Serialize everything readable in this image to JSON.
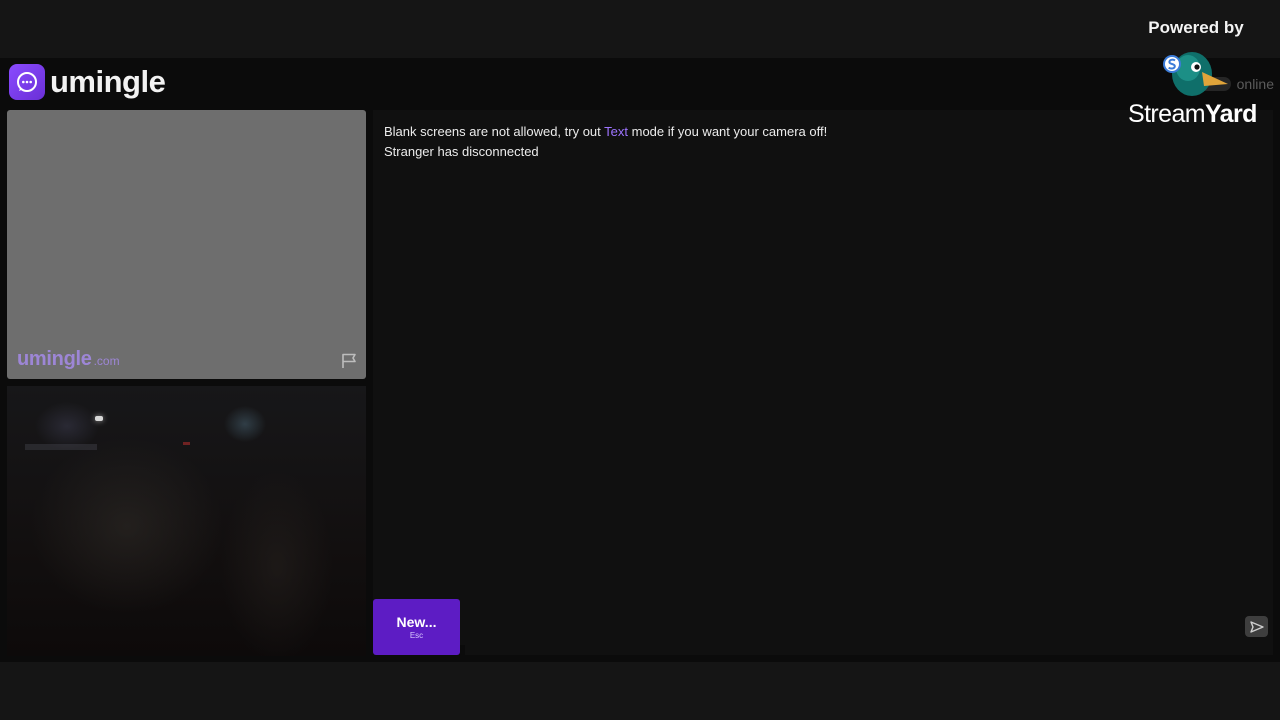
{
  "header": {
    "app_name": "umingle",
    "online_label": "online"
  },
  "stranger_video": {
    "watermark_main": "umingle",
    "watermark_suffix": ".com"
  },
  "chat": {
    "line1_before": "Blank screens are not allowed, try out ",
    "line1_link": "Text",
    "line1_after": " mode if you want your camera off!",
    "line2": "Stranger has disconnected"
  },
  "controls": {
    "new_label": "New...",
    "new_shortcut": "Esc",
    "message_value": "",
    "message_placeholder": ""
  },
  "overlay": {
    "powered_by": "Powered by",
    "brand_part1": "Stream",
    "brand_part2": "Yard"
  },
  "colors": {
    "accent": "#5d1cc4",
    "link": "#9d74ff",
    "watermark": "#9d86d6",
    "background": "#0b0b0b"
  },
  "icons": {
    "brand": "chat-bubble-icon",
    "report": "flag-icon",
    "send": "send-arrow-icon",
    "overlay_logo": "streamyard-duck-icon"
  }
}
